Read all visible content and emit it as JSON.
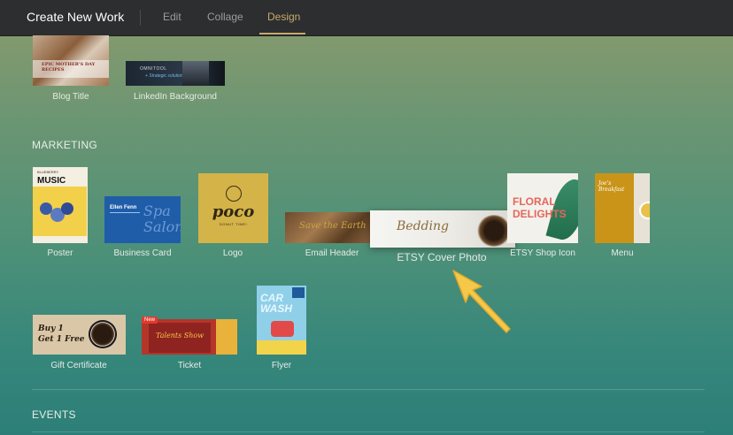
{
  "header": {
    "title": "Create New Work",
    "tabs": [
      {
        "label": "Edit",
        "active": false
      },
      {
        "label": "Collage",
        "active": false
      },
      {
        "label": "Design",
        "active": true
      }
    ]
  },
  "social": {
    "items": [
      {
        "label": "Blog Title",
        "thumb_text": "EPIC MOTHER'S DAY RECIPES"
      },
      {
        "label": "LinkedIn Background",
        "thumb_text": [
          "OMNITOOL",
          "+ Strategic solutions"
        ]
      }
    ]
  },
  "marketing": {
    "title": "MARKETING",
    "items": [
      {
        "label": "Poster",
        "thumb_text": [
          "BLUEBERRY",
          "MUSIC"
        ]
      },
      {
        "label": "Business Card",
        "thumb_text": [
          "Ellen Fenn",
          "Spa Salon"
        ]
      },
      {
        "label": "Logo",
        "thumb_text": [
          "poco",
          "DONUT TIME!"
        ]
      },
      {
        "label": "Email Header",
        "thumb_text": "Save the Earth"
      },
      {
        "label": "ETSY Cover Photo",
        "thumb_text": "Bedding",
        "highlighted": true
      },
      {
        "label": "ETSY Shop Icon",
        "thumb_text": [
          "FLORAL",
          "DELIGHTS"
        ]
      },
      {
        "label": "Menu",
        "thumb_text": [
          "Joe's",
          "Breakfast"
        ]
      },
      {
        "label": "Gift Certificate",
        "thumb_text": [
          "Buy 1",
          "Get 1 Free"
        ]
      },
      {
        "label": "Ticket",
        "thumb_text": "Talents Show",
        "badge": "New"
      },
      {
        "label": "Flyer",
        "thumb_text": [
          "CAR",
          "WASH"
        ]
      }
    ]
  },
  "events": {
    "title": "EVENTS"
  },
  "colors": {
    "accent": "#c9a86a",
    "topbar": "#2c2e30",
    "arrow": "#f5c84a"
  },
  "pointer_icon": "arrow-pointer-icon"
}
